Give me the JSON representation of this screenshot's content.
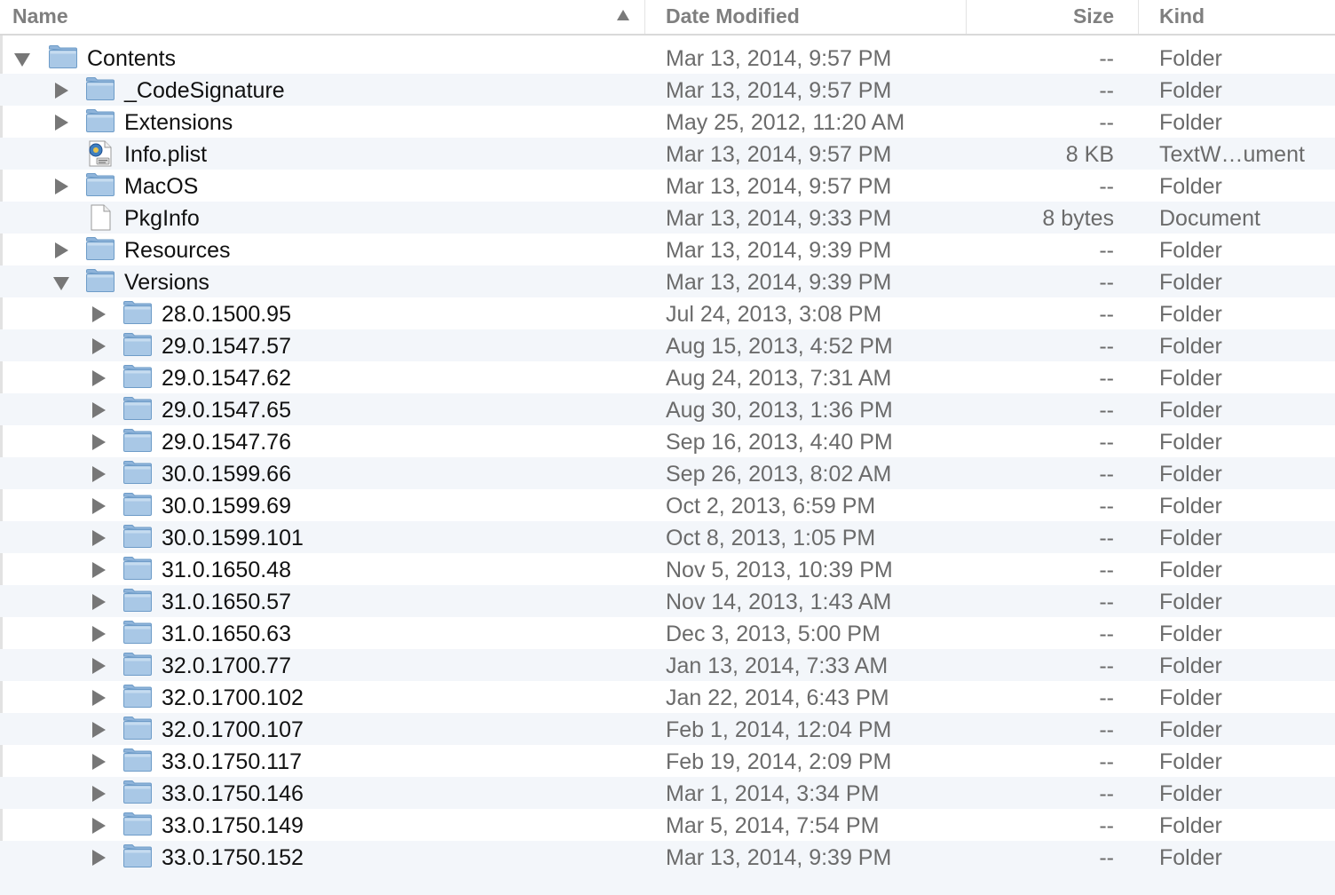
{
  "columns": {
    "name": "Name",
    "date": "Date Modified",
    "size": "Size",
    "kind": "Kind"
  },
  "rows": [
    {
      "name": "Contents",
      "date": "Mar 13, 2014, 9:57 PM",
      "size": "--",
      "kind": "Folder",
      "level": 0,
      "disclosure": "open",
      "icon": "folder-icon"
    },
    {
      "name": "_CodeSignature",
      "date": "Mar 13, 2014, 9:57 PM",
      "size": "--",
      "kind": "Folder",
      "level": 1,
      "disclosure": "closed",
      "icon": "folder-icon"
    },
    {
      "name": "Extensions",
      "date": "May 25, 2012, 11:20 AM",
      "size": "--",
      "kind": "Folder",
      "level": 1,
      "disclosure": "closed",
      "icon": "folder-icon"
    },
    {
      "name": "Info.plist",
      "date": "Mar 13, 2014, 9:57 PM",
      "size": "8 KB",
      "kind": "TextW…ument",
      "level": 1,
      "disclosure": "none",
      "icon": "plist-file-icon"
    },
    {
      "name": "MacOS",
      "date": "Mar 13, 2014, 9:57 PM",
      "size": "--",
      "kind": "Folder",
      "level": 1,
      "disclosure": "closed",
      "icon": "folder-icon"
    },
    {
      "name": "PkgInfo",
      "date": "Mar 13, 2014, 9:33 PM",
      "size": "8 bytes",
      "kind": "Document",
      "level": 1,
      "disclosure": "none",
      "icon": "document-icon"
    },
    {
      "name": "Resources",
      "date": "Mar 13, 2014, 9:39 PM",
      "size": "--",
      "kind": "Folder",
      "level": 1,
      "disclosure": "closed",
      "icon": "folder-icon"
    },
    {
      "name": "Versions",
      "date": "Mar 13, 2014, 9:39 PM",
      "size": "--",
      "kind": "Folder",
      "level": 1,
      "disclosure": "open",
      "icon": "folder-icon"
    },
    {
      "name": "28.0.1500.95",
      "date": "Jul 24, 2013, 3:08 PM",
      "size": "--",
      "kind": "Folder",
      "level": 2,
      "disclosure": "closed",
      "icon": "folder-icon"
    },
    {
      "name": "29.0.1547.57",
      "date": "Aug 15, 2013, 4:52 PM",
      "size": "--",
      "kind": "Folder",
      "level": 2,
      "disclosure": "closed",
      "icon": "folder-icon"
    },
    {
      "name": "29.0.1547.62",
      "date": "Aug 24, 2013, 7:31 AM",
      "size": "--",
      "kind": "Folder",
      "level": 2,
      "disclosure": "closed",
      "icon": "folder-icon"
    },
    {
      "name": "29.0.1547.65",
      "date": "Aug 30, 2013, 1:36 PM",
      "size": "--",
      "kind": "Folder",
      "level": 2,
      "disclosure": "closed",
      "icon": "folder-icon"
    },
    {
      "name": "29.0.1547.76",
      "date": "Sep 16, 2013, 4:40 PM",
      "size": "--",
      "kind": "Folder",
      "level": 2,
      "disclosure": "closed",
      "icon": "folder-icon"
    },
    {
      "name": "30.0.1599.66",
      "date": "Sep 26, 2013, 8:02 AM",
      "size": "--",
      "kind": "Folder",
      "level": 2,
      "disclosure": "closed",
      "icon": "folder-icon"
    },
    {
      "name": "30.0.1599.69",
      "date": "Oct 2, 2013, 6:59 PM",
      "size": "--",
      "kind": "Folder",
      "level": 2,
      "disclosure": "closed",
      "icon": "folder-icon"
    },
    {
      "name": "30.0.1599.101",
      "date": "Oct 8, 2013, 1:05 PM",
      "size": "--",
      "kind": "Folder",
      "level": 2,
      "disclosure": "closed",
      "icon": "folder-icon"
    },
    {
      "name": "31.0.1650.48",
      "date": "Nov 5, 2013, 10:39 PM",
      "size": "--",
      "kind": "Folder",
      "level": 2,
      "disclosure": "closed",
      "icon": "folder-icon"
    },
    {
      "name": "31.0.1650.57",
      "date": "Nov 14, 2013, 1:43 AM",
      "size": "--",
      "kind": "Folder",
      "level": 2,
      "disclosure": "closed",
      "icon": "folder-icon"
    },
    {
      "name": "31.0.1650.63",
      "date": "Dec 3, 2013, 5:00 PM",
      "size": "--",
      "kind": "Folder",
      "level": 2,
      "disclosure": "closed",
      "icon": "folder-icon"
    },
    {
      "name": "32.0.1700.77",
      "date": "Jan 13, 2014, 7:33 AM",
      "size": "--",
      "kind": "Folder",
      "level": 2,
      "disclosure": "closed",
      "icon": "folder-icon"
    },
    {
      "name": "32.0.1700.102",
      "date": "Jan 22, 2014, 6:43 PM",
      "size": "--",
      "kind": "Folder",
      "level": 2,
      "disclosure": "closed",
      "icon": "folder-icon"
    },
    {
      "name": "32.0.1700.107",
      "date": "Feb 1, 2014, 12:04 PM",
      "size": "--",
      "kind": "Folder",
      "level": 2,
      "disclosure": "closed",
      "icon": "folder-icon"
    },
    {
      "name": "33.0.1750.117",
      "date": "Feb 19, 2014, 2:09 PM",
      "size": "--",
      "kind": "Folder",
      "level": 2,
      "disclosure": "closed",
      "icon": "folder-icon"
    },
    {
      "name": "33.0.1750.146",
      "date": "Mar 1, 2014, 3:34 PM",
      "size": "--",
      "kind": "Folder",
      "level": 2,
      "disclosure": "closed",
      "icon": "folder-icon"
    },
    {
      "name": "33.0.1750.149",
      "date": "Mar 5, 2014, 7:54 PM",
      "size": "--",
      "kind": "Folder",
      "level": 2,
      "disclosure": "closed",
      "icon": "folder-icon"
    },
    {
      "name": "33.0.1750.152",
      "date": "Mar 13, 2014, 9:39 PM",
      "size": "--",
      "kind": "Folder",
      "level": 2,
      "disclosure": "closed",
      "icon": "folder-icon"
    }
  ],
  "sort": {
    "column": "name",
    "direction": "ascending"
  },
  "colors": {
    "row_alt": "#f3f6fa",
    "folder_fill": "#a9c8e6",
    "folder_stroke": "#6e9cc8",
    "text": "#111111",
    "secondary_text": "#6b6b6b"
  }
}
